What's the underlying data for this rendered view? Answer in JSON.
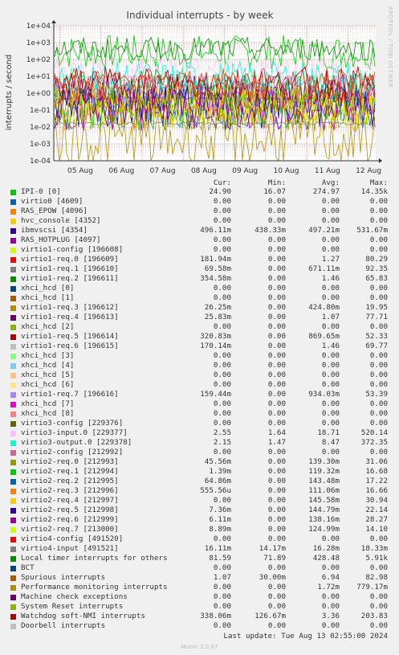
{
  "chart_data": {
    "type": "line",
    "title": "Individual interrupts - by week",
    "ylabel": "interrupts / second",
    "yscale": "log",
    "ylim": [
      0.0001,
      10000
    ],
    "yticks": [
      "1e-04",
      "1e-03",
      "1e-02",
      "1e-01",
      "1e+00",
      "1e+01",
      "1e+02",
      "1e+03",
      "1e+04"
    ],
    "xticks": [
      "05 Aug",
      "06 Aug",
      "07 Aug",
      "08 Aug",
      "09 Aug",
      "10 Aug",
      "11 Aug",
      "12 Aug"
    ],
    "grid": true,
    "side_label": "RRDTOOL / TOBI OETIKER",
    "columns": [
      "Cur:",
      "Min:",
      "Avg:",
      "Max:"
    ],
    "series": [
      {
        "name": "IPI-0 [0]",
        "color": "#00cc00",
        "cur": "24.90",
        "min": "16.07",
        "avg": "274.97",
        "max": "14.35k"
      },
      {
        "name": "virtio0 [4609]",
        "color": "#0066b3",
        "cur": "0.00",
        "min": "0.00",
        "avg": "0.00",
        "max": "0.00"
      },
      {
        "name": "RAS_EPOW [4096]",
        "color": "#ff8000",
        "cur": "0.00",
        "min": "0.00",
        "avg": "0.00",
        "max": "0.00"
      },
      {
        "name": "hvc_console [4352]",
        "color": "#ffcc00",
        "cur": "0.00",
        "min": "0.00",
        "avg": "0.00",
        "max": "0.00"
      },
      {
        "name": "ibmvscsi [4354]",
        "color": "#330099",
        "cur": "496.11m",
        "min": "438.33m",
        "avg": "497.21m",
        "max": "531.67m"
      },
      {
        "name": "RAS_HOTPLUG [4097]",
        "color": "#990099",
        "cur": "0.00",
        "min": "0.00",
        "avg": "0.00",
        "max": "0.00"
      },
      {
        "name": "virtio1-config [196608]",
        "color": "#ccff00",
        "cur": "0.00",
        "min": "0.00",
        "avg": "0.00",
        "max": "0.00"
      },
      {
        "name": "virtio1-req.0 [196609]",
        "color": "#ff0000",
        "cur": "181.94m",
        "min": "0.00",
        "avg": "1.27",
        "max": "80.29"
      },
      {
        "name": "virtio1-req.1 [196610]",
        "color": "#808080",
        "cur": "69.58m",
        "min": "0.00",
        "avg": "671.11m",
        "max": "92.35"
      },
      {
        "name": "virtio1-req.2 [196611]",
        "color": "#008f00",
        "cur": "354.58m",
        "min": "0.00",
        "avg": "1.46",
        "max": "65.83"
      },
      {
        "name": "xhci_hcd [0]",
        "color": "#00487d",
        "cur": "0.00",
        "min": "0.00",
        "avg": "0.00",
        "max": "0.00"
      },
      {
        "name": "xhci_hcd [1]",
        "color": "#b35a00",
        "cur": "0.00",
        "min": "0.00",
        "avg": "0.00",
        "max": "0.00"
      },
      {
        "name": "virtio1-req.3 [196612]",
        "color": "#b38f00",
        "cur": "26.25m",
        "min": "0.00",
        "avg": "424.80m",
        "max": "19.95"
      },
      {
        "name": "virtio1-req.4 [196613]",
        "color": "#6b006b",
        "cur": "25.83m",
        "min": "0.00",
        "avg": "1.07",
        "max": "77.71"
      },
      {
        "name": "xhci_hcd [2]",
        "color": "#8fb300",
        "cur": "0.00",
        "min": "0.00",
        "avg": "0.00",
        "max": "0.00"
      },
      {
        "name": "virtio1-req.5 [196614]",
        "color": "#b30000",
        "cur": "320.83m",
        "min": "0.00",
        "avg": "869.65m",
        "max": "52.33"
      },
      {
        "name": "virtio1-req.6 [196615]",
        "color": "#bebebe",
        "cur": "170.14m",
        "min": "0.00",
        "avg": "1.46",
        "max": "69.77"
      },
      {
        "name": "xhci_hcd [3]",
        "color": "#80ff80",
        "cur": "0.00",
        "min": "0.00",
        "avg": "0.00",
        "max": "0.00"
      },
      {
        "name": "xhci_hcd [4]",
        "color": "#80c9ff",
        "cur": "0.00",
        "min": "0.00",
        "avg": "0.00",
        "max": "0.00"
      },
      {
        "name": "xhci_hcd [5]",
        "color": "#ffc080",
        "cur": "0.00",
        "min": "0.00",
        "avg": "0.00",
        "max": "0.00"
      },
      {
        "name": "xhci_hcd [6]",
        "color": "#ffe680",
        "cur": "0.00",
        "min": "0.00",
        "avg": "0.00",
        "max": "0.00"
      },
      {
        "name": "virtio1-req.7 [196616]",
        "color": "#aa80ff",
        "cur": "159.44m",
        "min": "0.00",
        "avg": "934.03m",
        "max": "53.39"
      },
      {
        "name": "xhci_hcd [7]",
        "color": "#ee00cc",
        "cur": "0.00",
        "min": "0.00",
        "avg": "0.00",
        "max": "0.00"
      },
      {
        "name": "xhci_hcd [8]",
        "color": "#ff8080",
        "cur": "0.00",
        "min": "0.00",
        "avg": "0.00",
        "max": "0.00"
      },
      {
        "name": "virtio3-config [229376]",
        "color": "#666600",
        "cur": "0.00",
        "min": "0.00",
        "avg": "0.00",
        "max": "0.00"
      },
      {
        "name": "virtio3-input.0 [229377]",
        "color": "#ffbfff",
        "cur": "2.55",
        "min": "1.64",
        "avg": "18.71",
        "max": "520.14"
      },
      {
        "name": "virtio3-output.0 [229378]",
        "color": "#00ffcc",
        "cur": "2.15",
        "min": "1.47",
        "avg": "8.47",
        "max": "372.35"
      },
      {
        "name": "virtio2-config [212992]",
        "color": "#cc6699",
        "cur": "0.00",
        "min": "0.00",
        "avg": "0.00",
        "max": "0.00"
      },
      {
        "name": "virtio2-req.0 [212993]",
        "color": "#999900",
        "cur": "45.56m",
        "min": "0.00",
        "avg": "139.30m",
        "max": "31.06"
      },
      {
        "name": "virtio2-req.1 [212994]",
        "color": "#00cc00",
        "cur": "1.39m",
        "min": "0.00",
        "avg": "119.32m",
        "max": "16.68"
      },
      {
        "name": "virtio2-req.2 [212995]",
        "color": "#0066b3",
        "cur": "64.86m",
        "min": "0.00",
        "avg": "143.48m",
        "max": "17.22"
      },
      {
        "name": "virtio2-req.3 [212996]",
        "color": "#ff8000",
        "cur": "555.56u",
        "min": "0.00",
        "avg": "111.06m",
        "max": "16.66"
      },
      {
        "name": "virtio2-req.4 [212997]",
        "color": "#ffcc00",
        "cur": "0.00",
        "min": "0.00",
        "avg": "145.58m",
        "max": "30.94"
      },
      {
        "name": "virtio2-req.5 [212998]",
        "color": "#330099",
        "cur": "7.36m",
        "min": "0.00",
        "avg": "144.79m",
        "max": "22.14"
      },
      {
        "name": "virtio2-req.6 [212999]",
        "color": "#990099",
        "cur": "6.11m",
        "min": "0.00",
        "avg": "138.16m",
        "max": "28.27"
      },
      {
        "name": "virtio2-req.7 [213000]",
        "color": "#ccff00",
        "cur": "8.89m",
        "min": "0.00",
        "avg": "124.99m",
        "max": "14.10"
      },
      {
        "name": "virtio4-config [491520]",
        "color": "#ff0000",
        "cur": "0.00",
        "min": "0.00",
        "avg": "0.00",
        "max": "0.00"
      },
      {
        "name": "virtio4-input [491521]",
        "color": "#808080",
        "cur": "16.11m",
        "min": "14.17m",
        "avg": "16.28m",
        "max": "18.33m"
      },
      {
        "name": "Local timer interrupts for others",
        "color": "#008f00",
        "cur": "81.59",
        "min": "71.89",
        "avg": "428.48",
        "max": "5.91k"
      },
      {
        "name": "BCT",
        "color": "#00487d",
        "cur": "0.00",
        "min": "0.00",
        "avg": "0.00",
        "max": "0.00"
      },
      {
        "name": "Spurious interrupts",
        "color": "#b35a00",
        "cur": "1.07",
        "min": "30.00m",
        "avg": "6.94",
        "max": "82.98"
      },
      {
        "name": "Performance monitoring interrupts",
        "color": "#b38f00",
        "cur": "0.00",
        "min": "0.00",
        "avg": "1.72m",
        "max": "779.17m"
      },
      {
        "name": "Machine check exceptions",
        "color": "#6b006b",
        "cur": "0.00",
        "min": "0.00",
        "avg": "0.00",
        "max": "0.00"
      },
      {
        "name": "System Reset interrupts",
        "color": "#8fb300",
        "cur": "0.00",
        "min": "0.00",
        "avg": "0.00",
        "max": "0.00"
      },
      {
        "name": "Watchdog soft-NMI interrupts",
        "color": "#b30000",
        "cur": "338.06m",
        "min": "126.67m",
        "avg": "3.36",
        "max": "203.83"
      },
      {
        "name": "Doorbell interrupts",
        "color": "#bebebe",
        "cur": "0.00",
        "min": "0.00",
        "avg": "0.00",
        "max": "0.00"
      }
    ]
  },
  "last_update": "Last update: Tue Aug 13 02:55:00 2024",
  "footer": "Munin 2.0.67"
}
